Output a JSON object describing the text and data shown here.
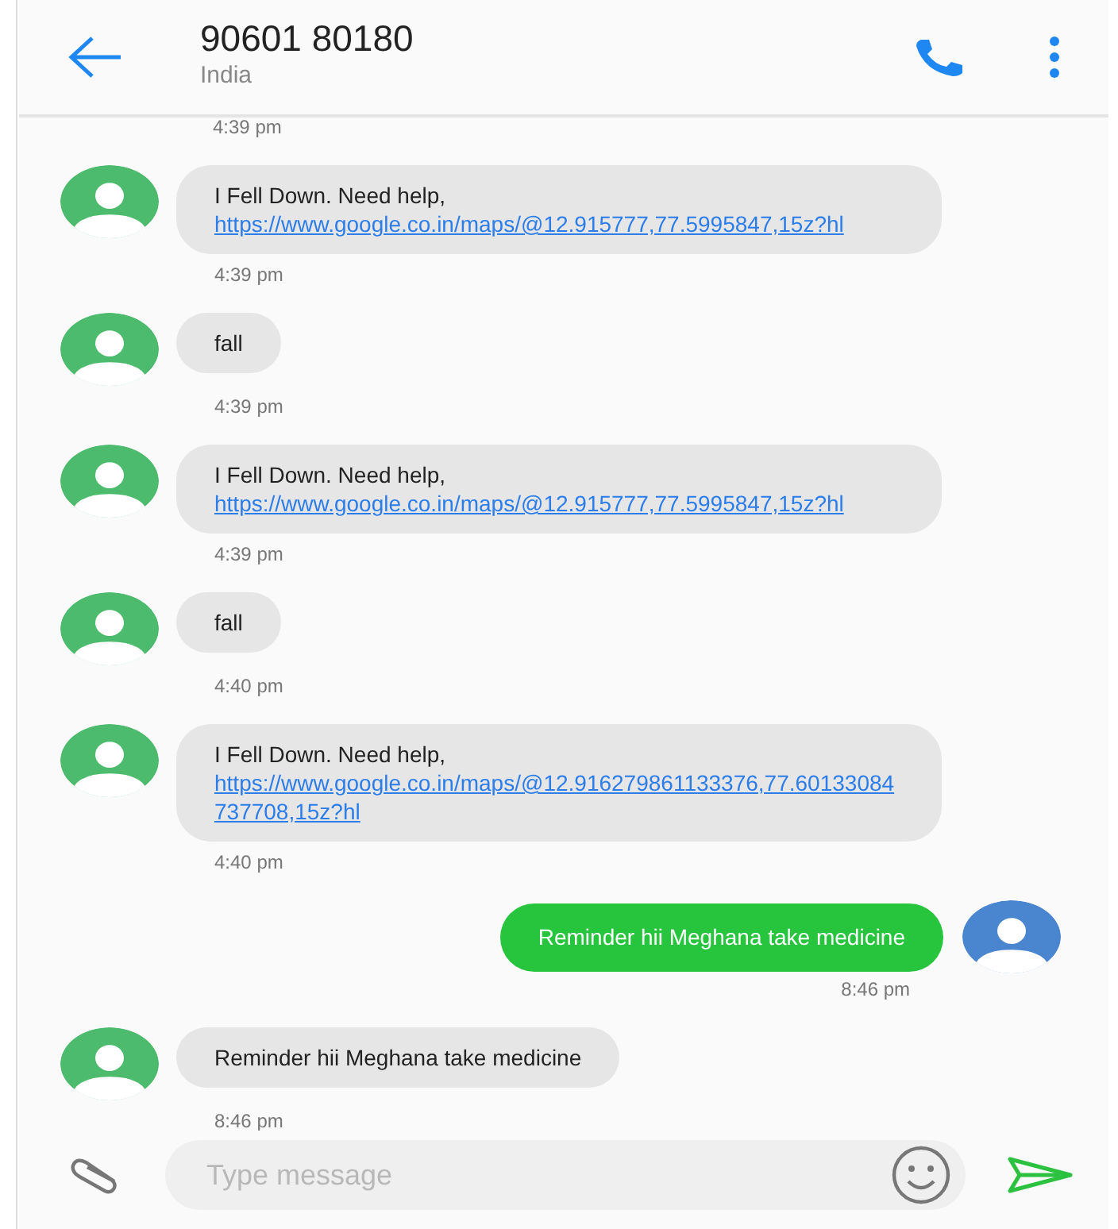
{
  "header": {
    "title": "90601 80180",
    "subtitle": "India"
  },
  "top_time": "4:39 pm",
  "messages": [
    {
      "kind": "incoming",
      "text": "I Fell Down. Need help,",
      "link": "https://www.google.co.in/maps/@12.915777,77.5995847,15z?hl",
      "time": "4:39 pm"
    },
    {
      "kind": "incoming",
      "text": "fall",
      "time": "4:39 pm"
    },
    {
      "kind": "incoming",
      "text": "I Fell Down. Need help,",
      "link": "https://www.google.co.in/maps/@12.915777,77.5995847,15z?hl",
      "time": "4:39 pm"
    },
    {
      "kind": "incoming",
      "text": "fall",
      "time": "4:40 pm"
    },
    {
      "kind": "incoming",
      "text": "I Fell Down. Need help,",
      "link": "https://www.google.co.in/maps/@12.916279861133376,77.60133084737708,15z?hl",
      "time": "4:40 pm"
    },
    {
      "kind": "outgoing",
      "text": "Reminder hii Meghana take medicine",
      "time": "8:46 pm"
    },
    {
      "kind": "incoming",
      "text": "Reminder hii Meghana take medicine",
      "time": "8:46 pm"
    }
  ],
  "composer": {
    "placeholder": "Type message"
  }
}
